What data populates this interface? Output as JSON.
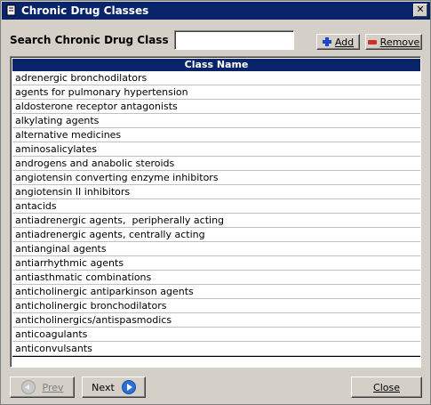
{
  "window": {
    "title": "Chronic Drug Classes",
    "close_glyph": "✕"
  },
  "search": {
    "label": "Search Chronic Drug Class",
    "value": ""
  },
  "toolbar": {
    "add_label": "Add",
    "remove_label": "Remove"
  },
  "grid": {
    "column_header": "Class Name",
    "rows": [
      "adrenergic bronchodilators",
      "agents for pulmonary hypertension",
      "aldosterone receptor antagonists",
      "alkylating agents",
      "alternative medicines",
      "aminosalicylates",
      "androgens and anabolic steroids",
      "angiotensin converting enzyme inhibitors",
      "angiotensin II inhibitors",
      "antacids",
      "antiadrenergic agents,  peripherally acting",
      "antiadrenergic agents, centrally acting",
      "antianginal agents",
      "antiarrhythmic agents",
      "antiasthmatic combinations",
      "anticholinergic antiparkinson agents",
      "anticholinergic bronchodilators",
      "anticholinergics/antispasmodics",
      "anticoagulants",
      "anticonvulsants"
    ]
  },
  "footer": {
    "prev_label": "Prev",
    "next_label": "Next",
    "close_label": "Close"
  },
  "colors": {
    "titlebar": "#0a246a",
    "header": "#0a246a",
    "face": "#d4d0c8"
  }
}
